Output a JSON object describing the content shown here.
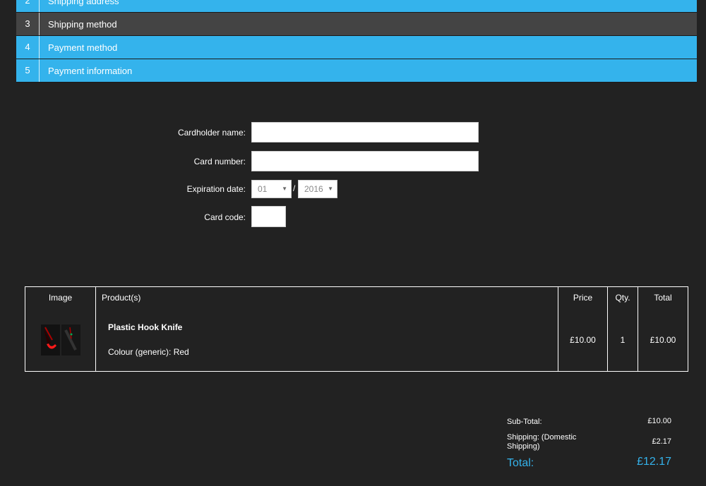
{
  "steps": [
    {
      "num": "2",
      "label": "Shipping address",
      "style": "blue"
    },
    {
      "num": "3",
      "label": "Shipping method",
      "style": "grey"
    },
    {
      "num": "4",
      "label": "Payment method",
      "style": "blue"
    },
    {
      "num": "5",
      "label": "Payment information",
      "style": "blue"
    }
  ],
  "payment_form": {
    "cardholder_label": "Cardholder name:",
    "cardholder_value": "",
    "card_number_label": "Card number:",
    "card_number_value": "",
    "expiration_label": "Expiration date:",
    "exp_month": "01",
    "exp_separator": "/",
    "exp_year": "2016",
    "card_code_label": "Card code:",
    "card_code_value": ""
  },
  "cart": {
    "headers": {
      "image": "Image",
      "products": "Product(s)",
      "price": "Price",
      "qty": "Qty.",
      "total": "Total"
    },
    "rows": [
      {
        "name": "Plastic Hook Knife",
        "option": "Colour (generic): Red",
        "price": "£10.00",
        "qty": "1",
        "total": "£10.00"
      }
    ]
  },
  "totals": {
    "subtotal_label": "Sub-Total:",
    "subtotal_value": "£10.00",
    "shipping_label": "Shipping: (Domestic Shipping)",
    "shipping_value": "£2.17",
    "total_label": "Total:",
    "total_value": "£12.17"
  },
  "colors": {
    "accent": "#34b3ec",
    "background": "#222222",
    "active_step": "#444444"
  }
}
